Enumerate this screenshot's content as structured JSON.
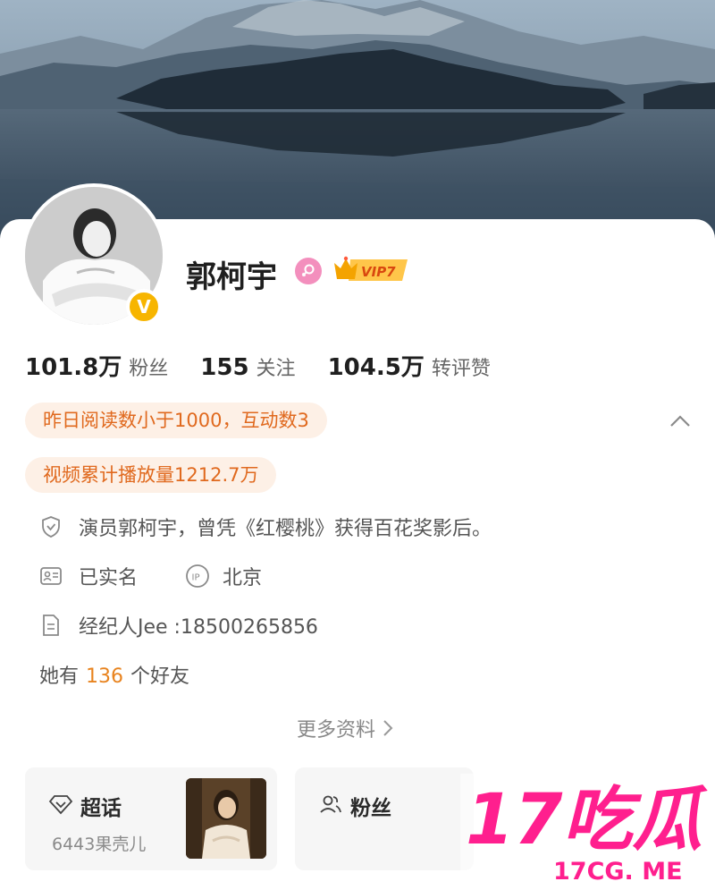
{
  "profile": {
    "name": "郭柯宇",
    "vip_label": "VIP7",
    "verified_badge": "V"
  },
  "stats": [
    {
      "value": "101.8万",
      "label": "粉丝"
    },
    {
      "value": "155",
      "label": "关注"
    },
    {
      "value": "104.5万",
      "label": "转评赞"
    }
  ],
  "highlights": {
    "reading": "昨日阅读数小于1000，互动数3",
    "video": "视频累计播放量1212.7万"
  },
  "info": {
    "verification": "演员郭柯宇，曾凭《红樱桃》获得百花奖影后。",
    "real_name": "已实名",
    "ip_location": "北京",
    "agent": "经纪人Jee :18500265856"
  },
  "friends": {
    "prefix": "她有",
    "count": "136",
    "suffix": "个好友"
  },
  "more_info": "更多资料",
  "tiles": {
    "super_topic": {
      "title": "超话",
      "subtitle": "6443果壳儿"
    },
    "fans_group": {
      "title": "粉丝"
    }
  },
  "watermark": {
    "brand": "17吃瓜",
    "url": "17CG. ME"
  },
  "icons": {
    "gender": "female-icon",
    "collapse": "chevron-up-icon",
    "verification": "shield-check-icon",
    "real_name": "id-card-icon",
    "ip": "ip-icon",
    "agent": "document-icon",
    "super_topic": "diamond-icon",
    "fans_group": "people-icon"
  },
  "colors": {
    "accent_orange": "#e0691e",
    "pill_bg": "#fdf0e6",
    "vip_gold": "#f7b500",
    "female_pink": "#f38fbd",
    "watermark_pink": "#ff1f8e"
  }
}
